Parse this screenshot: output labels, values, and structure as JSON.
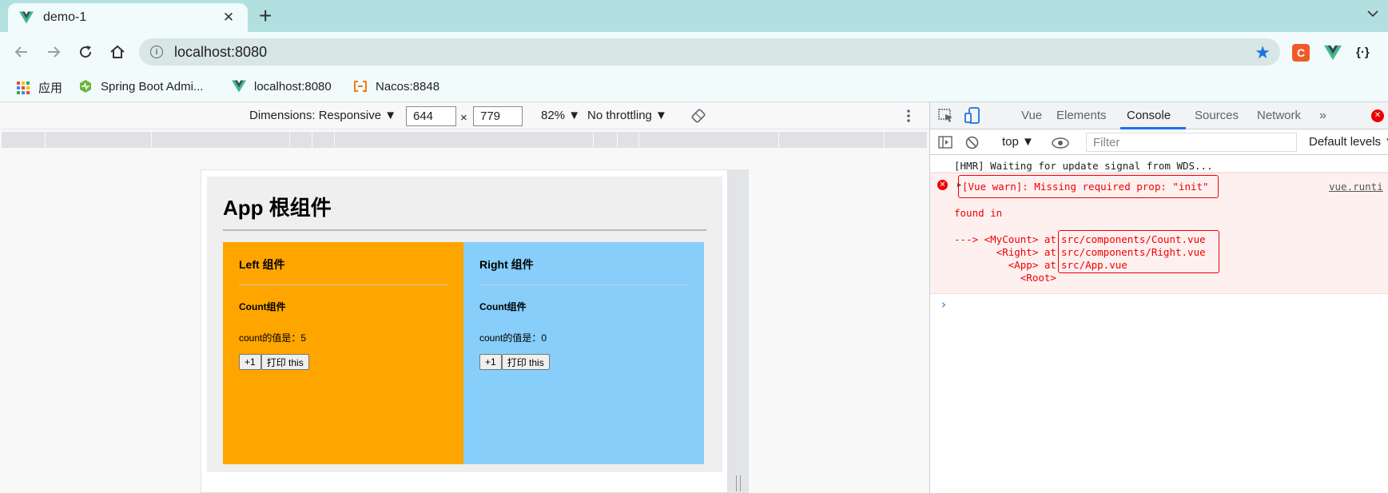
{
  "browser": {
    "tab_title": "demo-1",
    "url": "localhost:8080",
    "bookmarks": [
      {
        "label": "应用",
        "icon": "apps-grid-icon"
      },
      {
        "label": "Spring Boot Admi...",
        "icon": "spring-boot-admin-icon"
      },
      {
        "label": "localhost:8080",
        "icon": "vue-logo-icon"
      },
      {
        "label": "Nacos:8848",
        "icon": "nacos-icon"
      }
    ],
    "extensions": [
      "csdn-extension-icon",
      "vue-devtools-icon",
      "json-viewer-icon"
    ]
  },
  "device_toolbar": {
    "dimensions_label": "Dimensions: Responsive ▼",
    "width": "644",
    "times": "×",
    "height": "779",
    "zoom": "82% ▼",
    "throttling": "No throttling ▼"
  },
  "app": {
    "title": "App 根组件",
    "left": {
      "title": "Left 组件",
      "count_title": "Count组件",
      "count_text": "count的值是：5",
      "plus_label": "+1",
      "print_label": "打印 this"
    },
    "right": {
      "title": "Right 组件",
      "count_title": "Count组件",
      "count_text": "count的值是：0",
      "plus_label": "+1",
      "print_label": "打印 this"
    }
  },
  "devtools": {
    "tabs": [
      "Vue",
      "Elements",
      "Console",
      "Sources",
      "Network"
    ],
    "active_tab": "Console",
    "context": "top ▼",
    "filter_placeholder": "Filter",
    "levels": "Default levels ▼",
    "console": {
      "hmr_line": "[HMR] Waiting for update signal from WDS...",
      "warn_message": "[Vue warn]: Missing required prop: \"init\"",
      "warn_source": "vue.runti",
      "found_in": "found in",
      "trace": [
        {
          "prefix": "---> <MyCount> at ",
          "path": "src/components/Count.vue"
        },
        {
          "prefix": "       <Right> at ",
          "path": "src/components/Right.vue"
        },
        {
          "prefix": "         <App> at ",
          "path": "src/App.vue"
        },
        {
          "prefix": "           <Root>",
          "path": ""
        }
      ],
      "prompt": "›"
    }
  }
}
